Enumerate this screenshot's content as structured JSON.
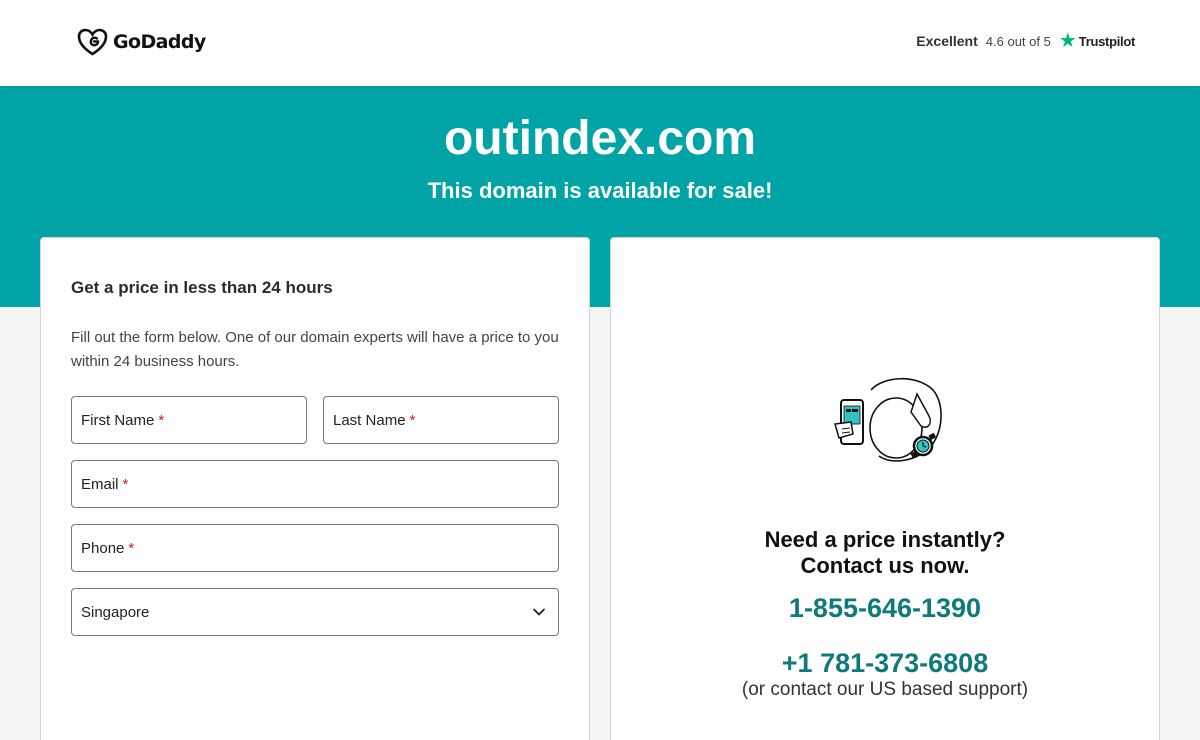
{
  "header": {
    "logo_text": "GoDaddy",
    "rating_word": "Excellent",
    "rating_score": "4.6 out of 5",
    "rating_brand": "Trustpilot",
    "rating_icon": "star-icon"
  },
  "hero": {
    "domain": "outindex.com",
    "subtitle": "This domain is available for sale!"
  },
  "form": {
    "title": "Get a price in less than 24 hours",
    "description": "Fill out the form below. One of our domain experts will have a price to you within 24 business hours.",
    "first_name_label": "First Name",
    "last_name_label": "Last Name",
    "email_label": "Email",
    "phone_label": "Phone",
    "required_mark": "*",
    "country_value": "Singapore"
  },
  "contact": {
    "heading_line1": "Need a price instantly?",
    "heading_line2": "Contact us now.",
    "phone_primary": "1-855-646-1390",
    "phone_secondary": "+1 781-373-6808",
    "support_note": "(or contact our US based support)"
  },
  "colors": {
    "brand_teal": "#00a4a6",
    "phone_teal": "#0e7a7c",
    "trustpilot_green": "#00b67a",
    "required_red": "#d41a1a"
  }
}
